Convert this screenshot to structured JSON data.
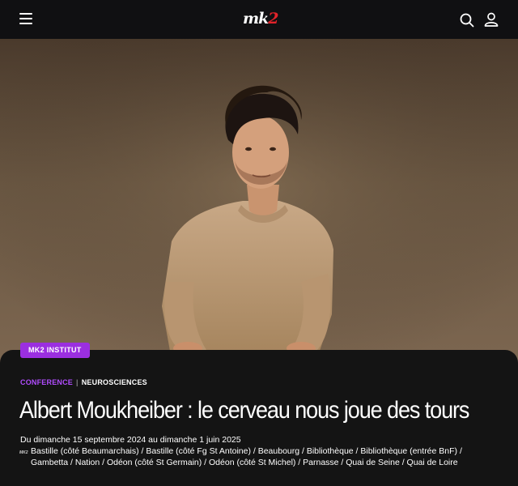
{
  "header": {
    "logo_left": "mk",
    "logo_right": "2",
    "menu_icon": "hamburger-icon",
    "search_icon": "search-icon",
    "account_icon": "user-icon"
  },
  "hero": {
    "badge": "MK2 INSTITUT"
  },
  "event": {
    "tags": [
      "CONFERENCE",
      "NEUROSCIENCES"
    ],
    "title": "Albert Moukheiber : le cerveau nous joue des tours",
    "dates": "Du dimanche 15 septembre 2024 au dimanche 1 juin 2025",
    "location_icon": "mk2-mini-logo",
    "location_icon_text": "MK2",
    "locations": "Bastille (côté Beaumarchais) / Bastille (côté Fg St Antoine) / Beaubourg / Bibliothèque / Bibliothèque (entrée BnF) / Gambetta / Nation / Odéon (côté St Germain) / Odéon (côté St Michel) / Parnasse / Quai de Seine / Quai de Loire"
  },
  "colors": {
    "badge": "#9b2fe0",
    "tag_accent": "#b14cff",
    "logo_accent": "#e2232a",
    "panel": "#141414"
  }
}
